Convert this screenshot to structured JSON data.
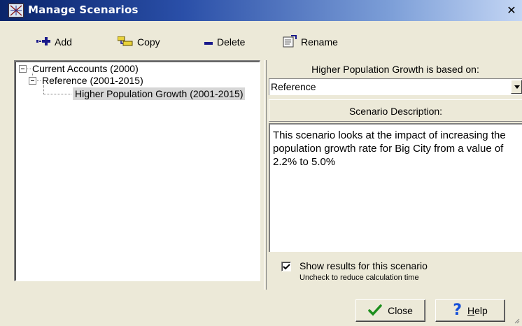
{
  "window": {
    "title": "Manage Scenarios",
    "close_glyph": "✕"
  },
  "toolbar": {
    "add_label": "Add",
    "copy_label": "Copy",
    "delete_label": "Delete",
    "rename_label": "Rename"
  },
  "tree": {
    "items": [
      {
        "label": "Current Accounts (2000)",
        "level": 0,
        "expanded": true
      },
      {
        "label": "Reference (2001-2015)",
        "level": 1,
        "expanded": true
      },
      {
        "label": "Higher Population Growth (2001-2015)",
        "level": 2,
        "selected": true
      }
    ]
  },
  "scenario": {
    "based_on_header": "Higher Population Growth is based on:",
    "based_on_value": "Reference",
    "description_header": "Scenario Description:",
    "description_text": "This scenario looks at the impact of increasing the population growth rate for Big City from a value of 2.2% to 5.0%",
    "show_results_label": "Show results for this scenario",
    "show_results_hint": "Uncheck to reduce calculation time",
    "show_results_checked": true
  },
  "buttons": {
    "close_label": "Close",
    "help_label": "Help"
  },
  "icons": {
    "app": "scenario-app-icon",
    "add": "add-icon",
    "copy": "copy-icon",
    "delete": "delete-icon",
    "rename": "rename-icon",
    "close": "checkmark-icon",
    "help": "question-icon"
  },
  "colors": {
    "title_bar_start": "#0a246a",
    "title_bar_end": "#c4d6f4",
    "face": "#ece9d8",
    "help_blue": "#1750d8",
    "check_green": "#1d8f1d"
  }
}
